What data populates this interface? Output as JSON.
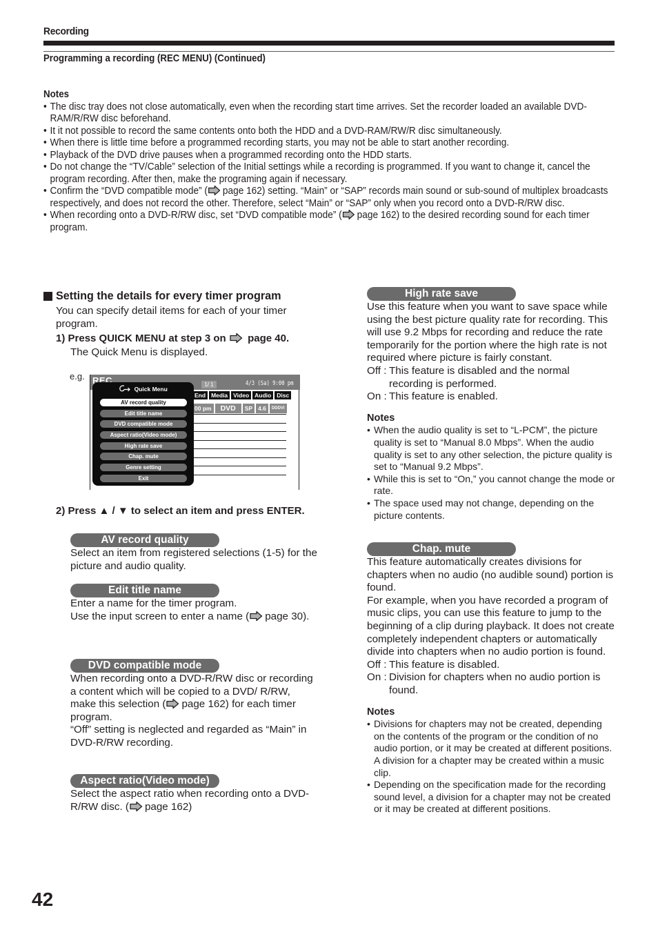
{
  "header": {
    "section": "Recording",
    "subtitle": "Programming a recording (REC MENU) (Continued)"
  },
  "top_notes": {
    "heading": "Notes",
    "items": [
      {
        "before": "The disc tray does not close automatically, even when the recording start time arrives. Set the recorder loaded an available DVD-RAM/R/RW disc beforehand.",
        "ref": "",
        "after": ""
      },
      {
        "before": "It it not possible to record the same contents onto both the HDD and a DVD-RAM/RW/R disc simultaneously.",
        "ref": "",
        "after": ""
      },
      {
        "before": "When there is little time before a programmed recording starts, you may not be able to start another recording.",
        "ref": "",
        "after": ""
      },
      {
        "before": "Playback of the DVD drive pauses when a programmed recording onto the HDD starts.",
        "ref": "",
        "after": ""
      },
      {
        "before": "Do not change the “TV/Cable” selection of the Initial settings while a recording is programmed. If you want to change it, cancel the program recording. After then, make the programing again if necessary.",
        "ref": "",
        "after": ""
      },
      {
        "before": "Confirm the “DVD compatible mode” (",
        "ref": "page 162",
        "after": ") setting. “Main” or “SAP” records main sound or sub-sound of multiplex broadcasts respectively, and does not record the other. Therefore, select “Main” or “SAP” only when you record onto a DVD-R/RW disc."
      },
      {
        "before": "When recording onto a DVD-R/RW disc, set “DVD compatible mode” (",
        "ref": "page 162",
        "after": ") to the desired recording sound for each timer program."
      }
    ]
  },
  "left": {
    "heading": "Setting the details for every timer program",
    "intro": "You can specify detail items for each of your timer program.",
    "step1": {
      "prefix": "1)  Press QUICK MENU at step 3 on",
      "ref": "page 40."
    },
    "step1_note": "The Quick Menu is displayed.",
    "eg_label": "e.g.",
    "screen": {
      "rec_label": "REC",
      "page_counter": "1/ 1",
      "date_time": "4/3 (Sa)  9:00  pm",
      "columns": [
        "End",
        "Media",
        "Video",
        "Audio",
        "Disc"
      ],
      "row": [
        "00 pm",
        "DVD",
        "SP",
        "4.6",
        "DDDVI"
      ],
      "quick_menu": {
        "title": "Quick Menu",
        "items": [
          "AV record quality",
          "Edit title name",
          "DVD compatible mode",
          "Aspect ratio(Video mode)",
          "High rate save",
          "Chap. mute",
          "Genre setting",
          "Exit"
        ],
        "selected_index": 0
      }
    },
    "step2": "2)  Press ▲ / ▼ to select an item and press ENTER.",
    "sections": {
      "av": {
        "title": "AV record quality",
        "body": "Select an item from registered selections (1-5) for the picture and audio quality."
      },
      "edit": {
        "title": "Edit title name",
        "line1": "Enter a name for the timer program.",
        "line2_before": "Use the input screen to enter a name (",
        "line2_ref": "page 30)."
      },
      "dvd": {
        "title": "DVD compatible mode",
        "body_before": "When recording onto a DVD-R/RW disc or recording a content which will be copied to a DVD/ R/RW, make this selection (",
        "ref": "page 162",
        "body_after": ") for each timer program.",
        "body2": "“Off” setting is neglected and regarded as “Main” in DVD-R/RW recording."
      },
      "aspect": {
        "title": "Aspect ratio(Video mode)",
        "body_before": "Select the aspect ratio when recording onto a DVD-R/RW disc. (",
        "ref": "page 162)"
      }
    }
  },
  "right": {
    "high_rate": {
      "title": "High rate save",
      "body": "Use this feature when you want to save space while using the best picture quality rate for recording. This will use 9.2 Mbps for recording and reduce the rate temporarily for the portion where the high rate is not required where picture is fairly constant.",
      "off_key": "Off :",
      "off_val": "This feature is disabled and the normal recording is performed.",
      "on_key": "On :",
      "on_val": "This feature is enabled.",
      "notes_heading": "Notes",
      "notes": [
        "When the audio quality is set to “L-PCM”, the picture quality is set to “Manual 8.0 Mbps”. When the audio quality is set to any other selection, the picture quality is set to “Manual 9.2 Mbps”.",
        "While this is set to “On,” you cannot change the mode or rate.",
        "The space used may not change, depending on the picture contents."
      ]
    },
    "chap_mute": {
      "title": "Chap. mute",
      "body1": "This feature automatically creates divisions for chapters when no audio (no audible sound) portion is found.",
      "body2": "For example, when you have recorded a program of music clips, you can use this feature to jump to the beginning of a clip during playback. It does not create completely independent chapters or automatically divide into chapters when no audio portion is found.",
      "off_key": "Off :",
      "off_val": "This feature is disabled.",
      "on_key": "On :",
      "on_val": "Division for chapters when no audio portion is found.",
      "notes_heading": "Notes",
      "notes": [
        "Divisions for chapters may not be created, depending on the contents of the program or the condition of no audio portion, or it may be created at different positions. A division for a chapter may be created within a music clip.",
        "Depending on the specification made for the recording sound level, a division for a chapter may not be created or it may be created at different positions."
      ]
    }
  },
  "page_number": "42"
}
